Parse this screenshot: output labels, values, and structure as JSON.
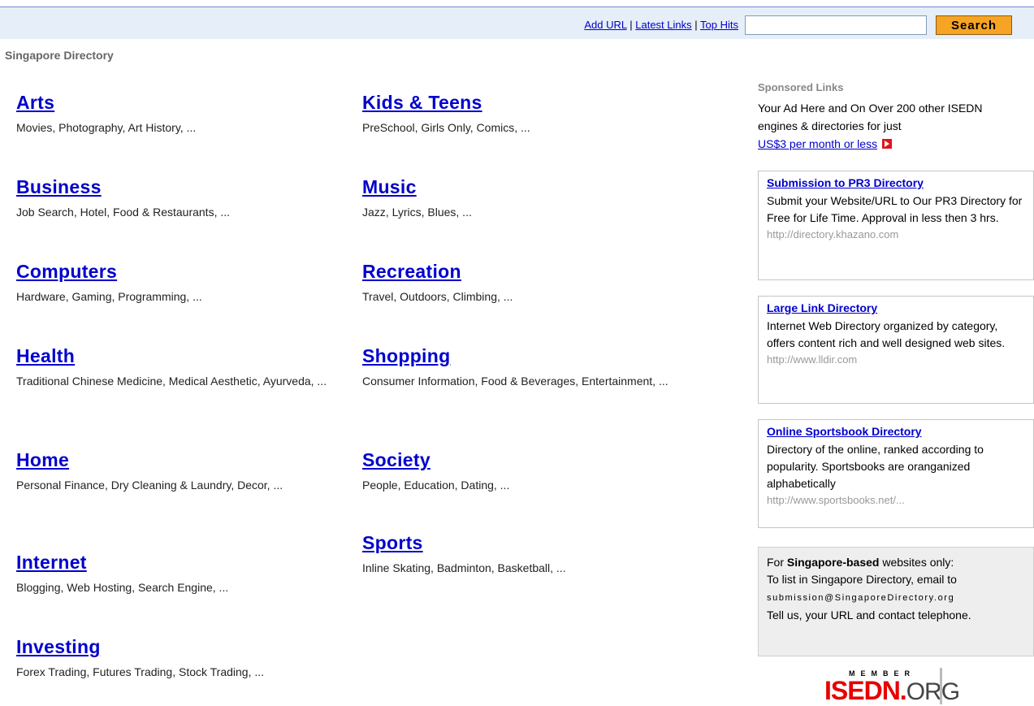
{
  "header": {
    "links": [
      "Add URL",
      "Latest Links",
      "Top Hits"
    ],
    "separator": "|",
    "search_placeholder": "",
    "search_button": "Search"
  },
  "site_title": "Singapore Directory",
  "categories_left": [
    {
      "name": "Arts",
      "sub": "Movies, Photography, Art History, ..."
    },
    {
      "name": "Business",
      "sub": "Job Search, Hotel, Food & Restaurants, ..."
    },
    {
      "name": "Computers",
      "sub": "Hardware, Gaming, Programming, ..."
    },
    {
      "name": "Health",
      "sub": "Traditional Chinese Medicine, Medical Aesthetic, Ayurveda, ..."
    },
    {
      "name": "Home",
      "sub": "Personal Finance, Dry Cleaning & Laundry, Decor, ..."
    },
    {
      "name": "Internet",
      "sub": "Blogging, Web Hosting, Search Engine, ..."
    },
    {
      "name": "Investing",
      "sub": "Forex Trading, Futures Trading, Stock Trading, ..."
    }
  ],
  "categories_mid": [
    {
      "name": "Kids & Teens",
      "sub": "PreSchool, Girls Only, Comics, ..."
    },
    {
      "name": "Music",
      "sub": "Jazz, Lyrics, Blues, ..."
    },
    {
      "name": "Recreation",
      "sub": "Travel, Outdoors, Climbing, ..."
    },
    {
      "name": "Shopping",
      "sub": "Consumer Information, Food & Beverages, Entertainment, ..."
    },
    {
      "name": "Society",
      "sub": "People, Education, Dating, ..."
    },
    {
      "name": "Sports",
      "sub": "Inline Skating, Badminton, Basketball, ..."
    }
  ],
  "sponsored": {
    "heading": "Sponsored Links",
    "text": "Your Ad Here and On Over 200 other ISEDN engines & directories for just",
    "price_link": "US$3 per month or less"
  },
  "ads": [
    {
      "title": "Submission to PR3 Directory",
      "desc": "Submit your Website/URL to Our PR3 Directory for Free for Life Time. Approval in less then 3 hrs.",
      "url": "http://directory.khazano.com"
    },
    {
      "title": "Large Link Directory",
      "desc": "Internet Web Directory organized by category, offers content rich and well designed web sites.",
      "url": "http://www.lldir.com"
    },
    {
      "title": "Online Sportsbook Directory",
      "desc": "Directory of the online, ranked according to popularity. Sportsbooks are oranganized alphabetically",
      "url": "http://www.sportsbooks.net/..."
    }
  ],
  "singapore_box": {
    "prefix": "For ",
    "bold": "Singapore-based",
    "line1_rest": " websites only:",
    "line2": "To list in Singapore Directory, email to",
    "email": "submission@SingaporeDirectory.org",
    "line3": "Tell us, your URL and contact telephone."
  },
  "badge": {
    "member": "MEMBER",
    "isedn": "ISEDN",
    "dot": ".",
    "org": "ORG"
  },
  "colors": {
    "link": "#0000cc",
    "button": "#f7a424",
    "topbar": "#e6eef9"
  }
}
